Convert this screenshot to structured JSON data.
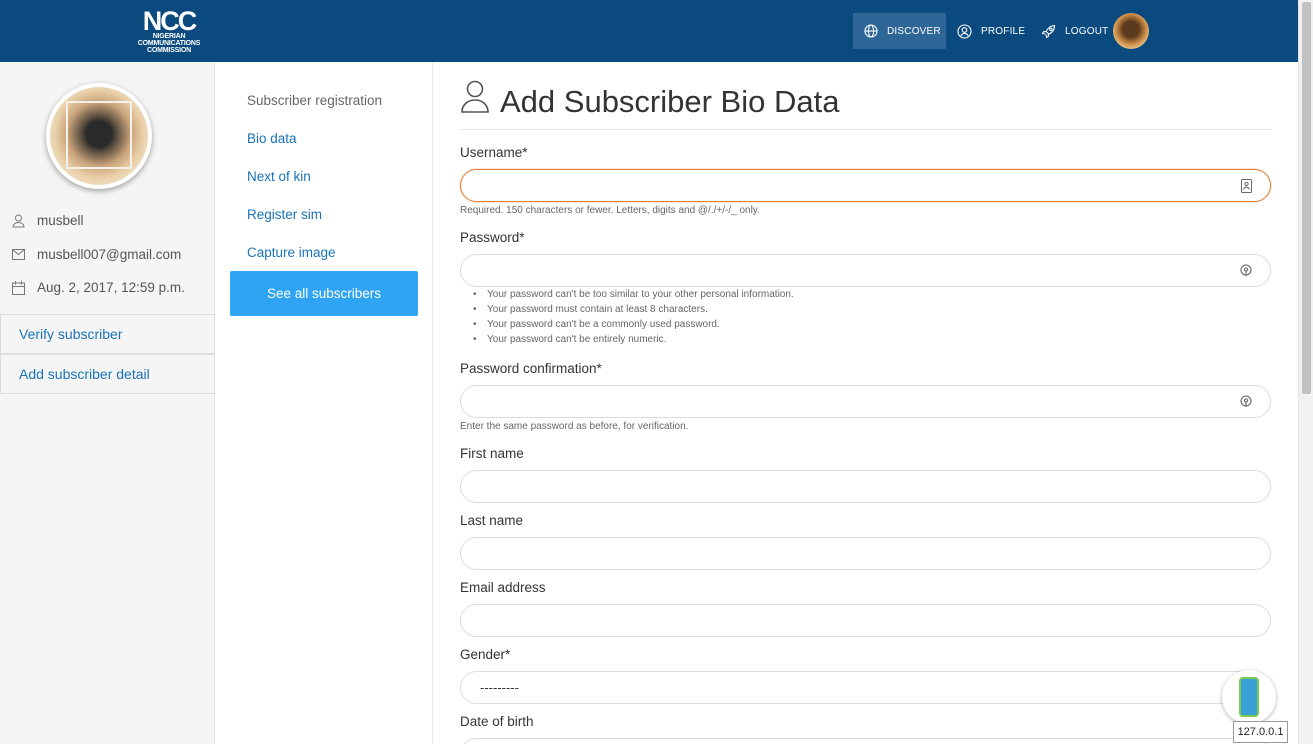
{
  "header": {
    "logo": {
      "acronym": "NCC",
      "line1": "NIGERIAN",
      "line2": "COMMUNICATIONS",
      "line3": "COMMISSION"
    },
    "nav": [
      {
        "label": "DISCOVER",
        "icon": "globe-icon"
      },
      {
        "label": "PROFILE",
        "icon": "user-circle-icon"
      },
      {
        "label": "LOGOUT",
        "icon": "rocket-icon"
      }
    ]
  },
  "profile": {
    "username": "musbell",
    "email": "musbell007@gmail.com",
    "joined": "Aug. 2, 2017, 12:59 p.m.",
    "links": [
      "Verify subscriber",
      "Add subscriber detail"
    ]
  },
  "subnav": {
    "heading": "Subscriber registration",
    "items": [
      "Bio data",
      "Next of kin",
      "Register sim",
      "Capture image"
    ],
    "button": "See all subscribers"
  },
  "form": {
    "title": "Add Subscriber Bio Data",
    "fields": {
      "username": {
        "label": "Username*",
        "help": "Required. 150 characters or fewer. Letters, digits and @/./+/-/_ only."
      },
      "password": {
        "label": "Password*"
      },
      "password_confirmation": {
        "label": "Password confirmation*",
        "help": "Enter the same password as before, for verification."
      },
      "first_name": {
        "label": "First name"
      },
      "last_name": {
        "label": "Last name"
      },
      "email": {
        "label": "Email address"
      },
      "gender": {
        "label": "Gender*",
        "value": "---------"
      },
      "dob": {
        "label": "Date of birth"
      }
    },
    "password_hints": [
      "Your password can't be too similar to your other personal information.",
      "Your password must contain at least 8 characters.",
      "Your password can't be a commonly used password.",
      "Your password can't be entirely numeric."
    ]
  },
  "footer": {
    "ip": "127.0.0.1"
  },
  "colors": {
    "header": "#0b4a7e",
    "accent": "#2fa4f3",
    "link": "#1a73b8",
    "error_border": "#e0823a"
  }
}
